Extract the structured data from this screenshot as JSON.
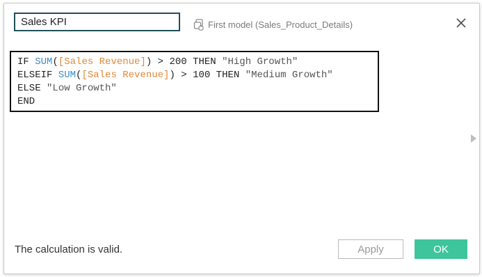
{
  "dialog": {
    "name_value": "Sales KPI",
    "datasource_icon": "datasource-icon",
    "datasource_label": "First model (Sales_Product_Details)",
    "close_icon": "close-icon"
  },
  "editor": {
    "lines": [
      [
        {
          "t": "IF ",
          "c": "kw"
        },
        {
          "t": "SUM",
          "c": "fn"
        },
        {
          "t": "(",
          "c": "kw"
        },
        {
          "t": "[Sales Revenue]",
          "c": "field"
        },
        {
          "t": ") > 200 THEN ",
          "c": "kw"
        },
        {
          "t": "\"High Growth\"",
          "c": "str"
        }
      ],
      [
        {
          "t": "ELSEIF ",
          "c": "kw"
        },
        {
          "t": "SUM",
          "c": "fn"
        },
        {
          "t": "(",
          "c": "kw"
        },
        {
          "t": "[Sales Revenue]",
          "c": "field"
        },
        {
          "t": ") > 100 THEN ",
          "c": "kw"
        },
        {
          "t": "\"Medium Growth\"",
          "c": "str"
        }
      ],
      [
        {
          "t": "ELSE ",
          "c": "kw"
        },
        {
          "t": "\"Low Growth\"",
          "c": "str"
        }
      ],
      [
        {
          "t": "END",
          "c": "kw"
        }
      ]
    ]
  },
  "footer": {
    "status": "The calculation is valid.",
    "apply_label": "Apply",
    "ok_label": "OK"
  },
  "colors": {
    "accent_ok": "#3ec59b",
    "function": "#3a8cc4",
    "field": "#e08a3a",
    "name_border": "#1f4e5b"
  }
}
